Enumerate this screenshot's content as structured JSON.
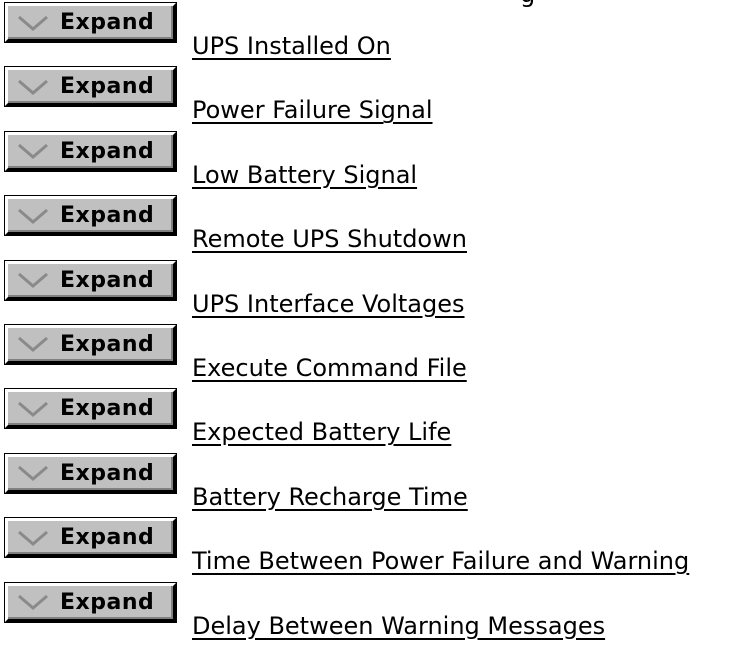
{
  "partial_header": "g",
  "expand_label": "Expand",
  "icons": {
    "expand": "chevron-down-icon"
  },
  "colors": {
    "button_face": "#c0c0c0",
    "chevron": "#8a8a8a",
    "text": "#000000"
  },
  "topics": [
    {
      "title": "UPS Installed On"
    },
    {
      "title": "Power Failure Signal"
    },
    {
      "title": "Low Battery Signal"
    },
    {
      "title": "Remote UPS Shutdown"
    },
    {
      "title": "UPS Interface Voltages"
    },
    {
      "title": "Execute Command File"
    },
    {
      "title": "Expected Battery Life"
    },
    {
      "title": "Battery Recharge Time"
    },
    {
      "title": "Time Between Power Failure and Warning"
    },
    {
      "title": "Delay Between Warning Messages"
    }
  ]
}
